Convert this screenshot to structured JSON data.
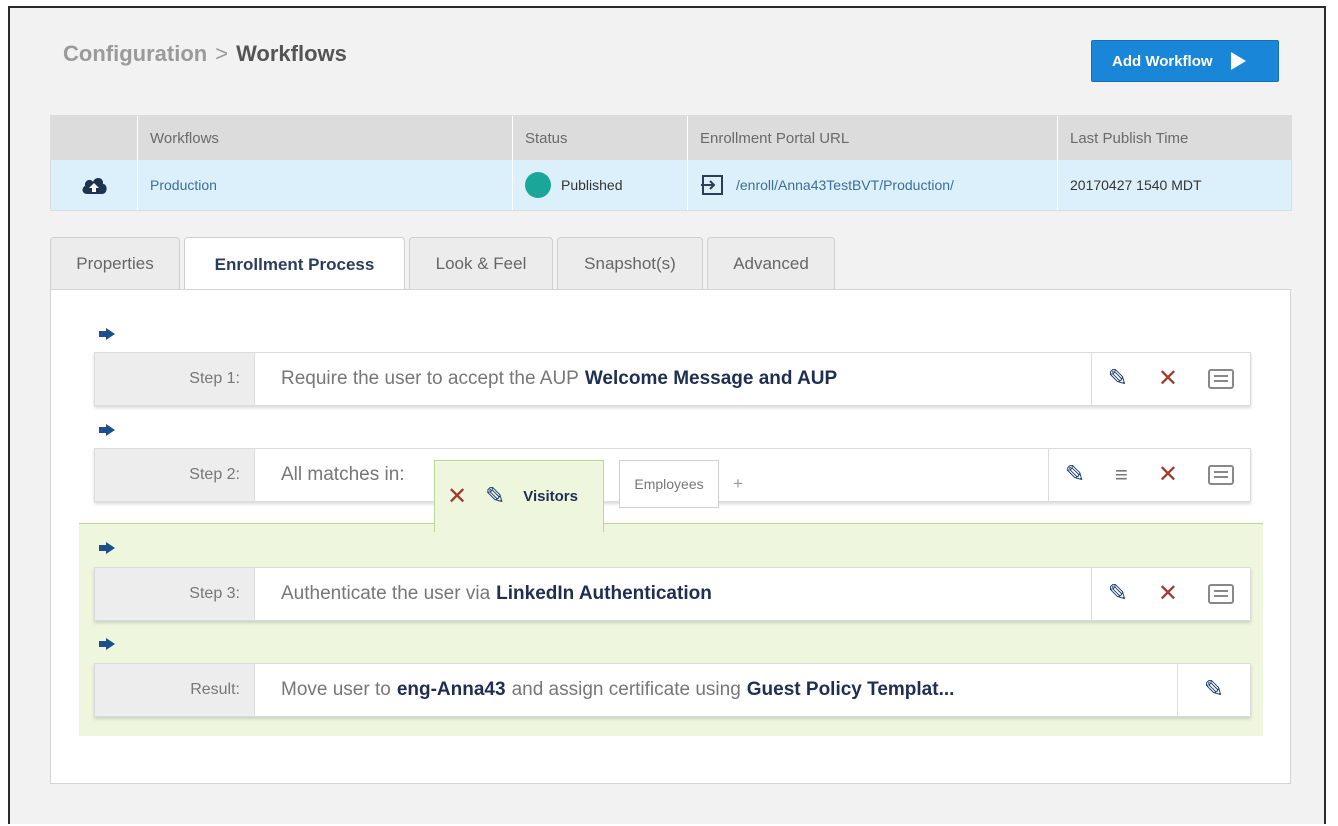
{
  "breadcrumb": {
    "parent": "Configuration",
    "separator": ">",
    "current": "Workflows"
  },
  "add_button": {
    "label": "Add Workflow"
  },
  "table": {
    "headers": [
      "",
      "Workflows",
      "Status",
      "Enrollment Portal URL",
      "Last Publish Time"
    ],
    "row": {
      "name": "Production",
      "status": "Published",
      "url": "/enroll/Anna43TestBVT/Production/",
      "publish_time": "20170427 1540 MDT",
      "status_color": "#1aa79a"
    }
  },
  "tabs": [
    {
      "label": "Properties",
      "active": false
    },
    {
      "label": "Enrollment Process",
      "active": true
    },
    {
      "label": "Look & Feel",
      "active": false
    },
    {
      "label": "Snapshot(s)",
      "active": false
    },
    {
      "label": "Advanced",
      "active": false
    }
  ],
  "steps": {
    "step1": {
      "label": "Step 1:",
      "text": "Require the user to accept the AUP",
      "highlight": "Welcome Message and AUP"
    },
    "step2": {
      "label": "Step 2:",
      "text": "All matches in:",
      "active_group": "Visitors",
      "other_group": "Employees",
      "add": "+"
    },
    "step3": {
      "label": "Step 3:",
      "text": "Authenticate the user via",
      "highlight": "LinkedIn Authentication"
    },
    "result": {
      "label": "Result:",
      "text_before": "Move user to",
      "group": "eng-Anna43",
      "text_mid": "and assign certificate using",
      "template": "Guest Policy Templat..."
    }
  },
  "icons": {
    "edit": "✎",
    "delete": "✕",
    "reorder": "≡",
    "cloud": "☁"
  },
  "colors": {
    "accent": "#1a86d8",
    "selected_row": "#dcf0fb",
    "delete": "#a23a2e",
    "edit": "#1d3f70"
  }
}
